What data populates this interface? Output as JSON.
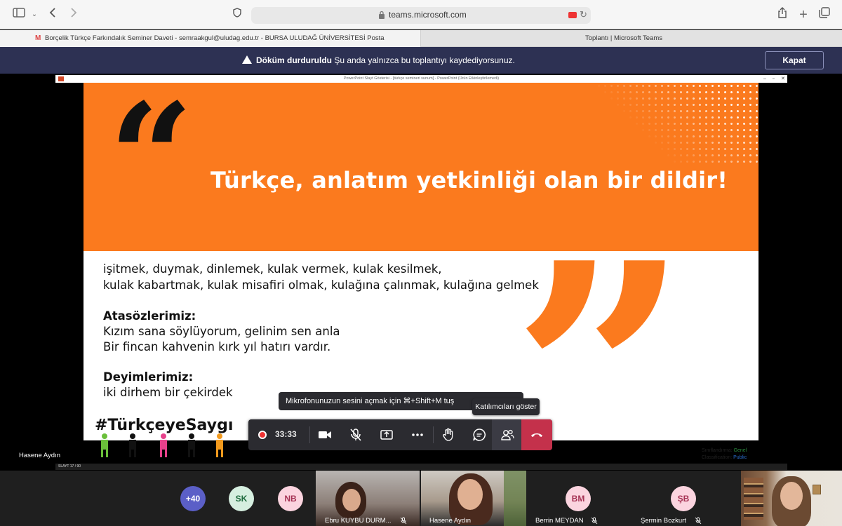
{
  "browser": {
    "url": "teams.microsoft.com",
    "tabs": [
      "Borçelik Türkçe Farkındalık Seminer Daveti - semraakgul@uludag.edu.tr - BURSA ULUDAĞ ÜNİVERSİTESİ Posta",
      "Toplantı | Microsoft Teams"
    ]
  },
  "banner": {
    "bold": "Döküm durduruldu",
    "text": "Şu anda yalnızca bu toplantıyı kaydediyorsunuz.",
    "button": "Kapat"
  },
  "ppt": {
    "title_bar": "PowerPoint Slayt Gösterisi - [türkçe semineri sunum] - PowerPoint (Ürün Etkinleştirilemedi)",
    "status": "SLAYT 17 / 90"
  },
  "slide": {
    "heading": "Türkçe, anlatım yetkinliği olan bir dildir!",
    "line1": "işitmek, duymak, dinlemek, kulak vermek, kulak kesilmek,",
    "line2": "kulak kabartmak, kulak misafiri olmak, kulağına çalınmak, kulağına gelmek",
    "proverbs_title": "Atasözlerimiz:",
    "proverb1": "Kızım sana söylüyorum, gelinim sen anla",
    "proverb2": "Bir fincan kahvenin kırk yıl hatırı vardır.",
    "idioms_title": "Deyimlerimiz:",
    "idiom1": "iki dirhem bir çekirdek",
    "hashtag": "#TürkçeyeSaygı",
    "classif1_label": "Sınıflandırma:",
    "classif1_value": "Genel",
    "classif2_label": "Classification:",
    "classif2_value": "Public",
    "colors": {
      "orange": "#fb7a1e",
      "dark": "#111111"
    }
  },
  "presenter": "Hasene Aydın",
  "tooltips": {
    "mic": "Mikrofonunuzun sesini açmak için ⌘+Shift+M tuş",
    "participants": "Katılımcıları göster"
  },
  "controls": {
    "timer": "33:33",
    "colors": {
      "bar": "#2b2b30",
      "hangup": "#c4314b",
      "record": "#e33333"
    }
  },
  "participants": {
    "overflow": "+40",
    "sk": "SK",
    "nb": "NB",
    "bm": "BM",
    "sb": "ŞB",
    "p_ebru": "Ebru KUYBU DURM...",
    "p_hasene": "Hasene Aydın",
    "p_berrin": "Berrin MEYDAN",
    "p_sermin": "Şermin Bozkurt"
  }
}
